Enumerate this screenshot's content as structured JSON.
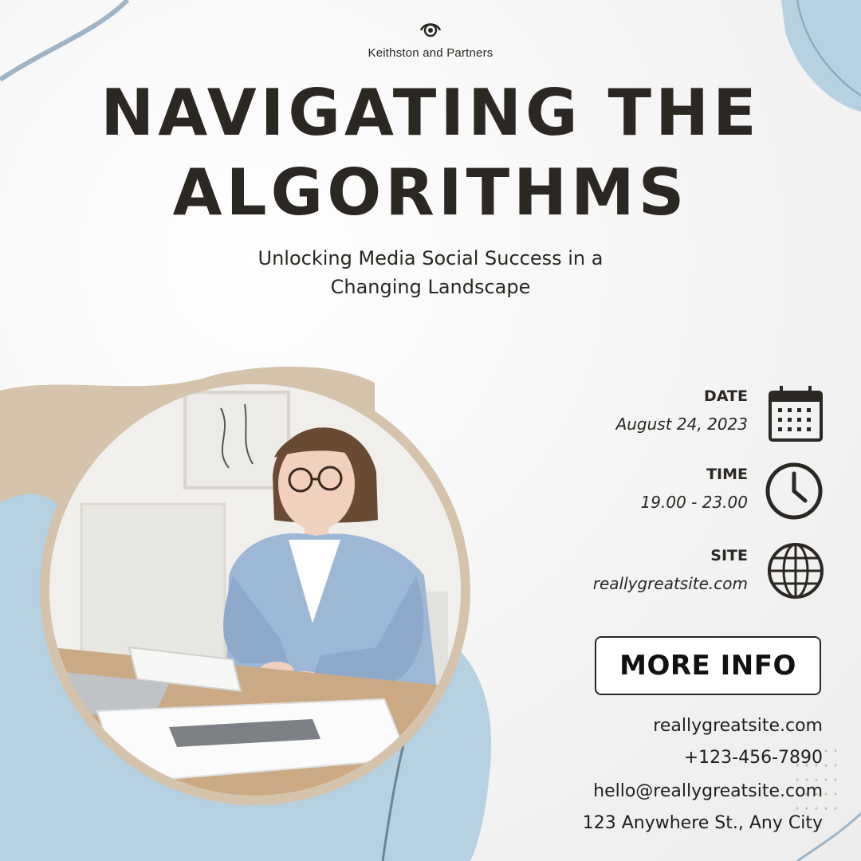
{
  "brand": {
    "name": "Keithston and Partners",
    "logo_icon": "eye-logo-icon"
  },
  "title": {
    "line1": "NAVIGATING THE",
    "line2": "ALGORITHMS"
  },
  "subtitle": {
    "line1": "Unlocking Media Social Success in a",
    "line2": "Changing Landscape"
  },
  "event": {
    "date_label": "DATE",
    "date_value": "August 24, 2023",
    "date_icon": "calendar-icon",
    "time_label": "TIME",
    "time_value": "19.00 - 23.00",
    "time_icon": "clock-icon",
    "site_label": "SITE",
    "site_value": "reallygreatsite.com",
    "site_icon": "globe-icon"
  },
  "button": {
    "label": "MORE INFO"
  },
  "contact": {
    "website": "reallygreatsite.com",
    "phone": "+123-456-7890",
    "email": "hello@reallygreatsite.com",
    "address": "123 Anywhere St., Any City"
  },
  "colors": {
    "text": "#2b2722",
    "blue_shape": "#b5d1e2",
    "tan_shape": "#d6c3ab",
    "accent_line": "#8aa4b8"
  }
}
